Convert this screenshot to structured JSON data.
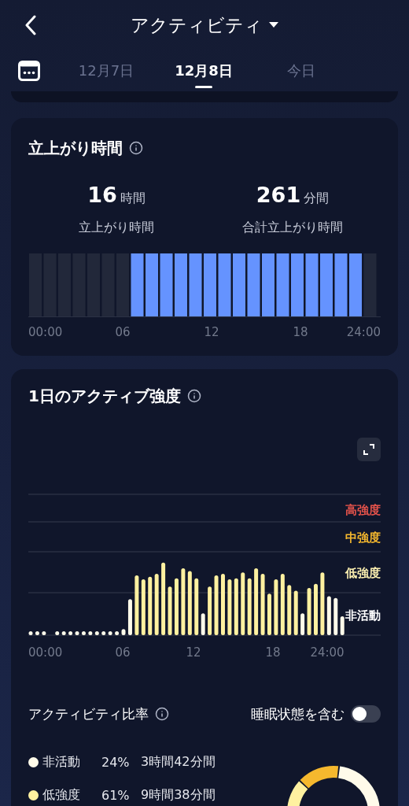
{
  "header": {
    "title": "アクティビティ"
  },
  "date_tabs": [
    {
      "label": "12月7日",
      "selected": false
    },
    {
      "label": "12月8日",
      "selected": true
    },
    {
      "label": "今日",
      "selected": false
    }
  ],
  "standing": {
    "title": "立上がり時間",
    "stats": [
      {
        "value": "16",
        "unit": "時間",
        "label": "立上がり時間"
      },
      {
        "value": "261",
        "unit": "分間",
        "label": "合計立上がり時間"
      }
    ],
    "hours": [
      {
        "active": false
      },
      {
        "active": false
      },
      {
        "active": false
      },
      {
        "active": false
      },
      {
        "active": false
      },
      {
        "active": false
      },
      {
        "active": false
      },
      {
        "active": true
      },
      {
        "active": true
      },
      {
        "active": true
      },
      {
        "active": true
      },
      {
        "active": true
      },
      {
        "active": true
      },
      {
        "active": true
      },
      {
        "active": true
      },
      {
        "active": true
      },
      {
        "active": true
      },
      {
        "active": true
      },
      {
        "active": true
      },
      {
        "active": true
      },
      {
        "active": true
      },
      {
        "active": true
      },
      {
        "active": true
      },
      {
        "active": false
      }
    ],
    "axis_labels": [
      "00:00",
      "06",
      "12",
      "18",
      "24:00"
    ]
  },
  "intensity": {
    "title": "1日のアクティブ強度",
    "levels": [
      {
        "label": "高強度",
        "color": "#e5534b"
      },
      {
        "label": "中強度",
        "color": "#f5b82e"
      },
      {
        "label": "低強度",
        "color": "#fbefb0"
      },
      {
        "label": "非活動",
        "color": "#ffffff"
      }
    ],
    "axis_labels": [
      "00:00",
      "06",
      "12",
      "18",
      "24:00"
    ],
    "ratio": {
      "title": "アクティビティ比率",
      "include_sleep": {
        "label": "睡眠状態を含む",
        "on": false
      },
      "legend": [
        {
          "label": "非活動",
          "percent": "24%",
          "duration": "3時間42分間",
          "color": "#fffbea"
        },
        {
          "label": "低強度",
          "percent": "61%",
          "duration": "9時間38分間",
          "color": "#fff1a0"
        }
      ]
    }
  }
}
